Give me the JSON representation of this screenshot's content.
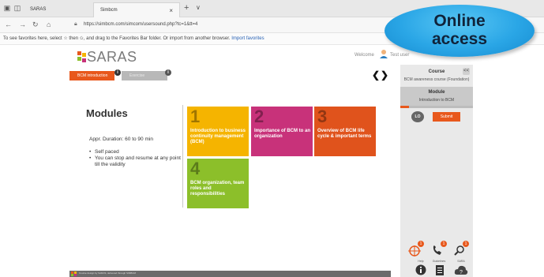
{
  "browser": {
    "tabs": [
      {
        "label": "SARAS"
      },
      {
        "label": "Simbcm",
        "close": "×"
      }
    ],
    "new_tab": "+",
    "tab_menu": "∨",
    "url": "https://simbcm.com/simcom/usersound.php?tc=1&tt=4",
    "favorites_text": "To see favorites here, select ☆ then ✩, and drag to the Favorites Bar folder. Or import from another browser.",
    "favorites_link": "Import favorites"
  },
  "bubble": {
    "line1": "Online",
    "line2": "access"
  },
  "app": {
    "logo_text": "SARAS",
    "welcome": "Welcome",
    "user": "Test user",
    "tabs": [
      {
        "label": "BCM introduction"
      },
      {
        "label": "Exercise"
      }
    ],
    "nav_prev": "❮",
    "nav_next": "❯",
    "modules_title": "Modules",
    "duration": "Appr. Duration: 60 to 90 min",
    "bullets": [
      "Self paced",
      "You can stop and resume at any point till the validity"
    ],
    "tiles": [
      {
        "num": "1",
        "label": "Introduction to business continuity management (BCM)",
        "color": "#f5b400"
      },
      {
        "num": "2",
        "label": "Importance of BCM to an organization",
        "color": "#c8327a"
      },
      {
        "num": "3",
        "label": "Overview of BCM life cycle & important terms",
        "color": "#e0531c"
      },
      {
        "num": "4",
        "label": "BCM organization, team roles and responsibilities",
        "color": "#8cbf2a"
      }
    ],
    "footer_text": "Course design by SARAS, delivered through SIMBCM"
  },
  "panel": {
    "course_title": "Course",
    "collapse": "<<",
    "course_name": "BCM awareness course (Foundation)",
    "module_title": "Module",
    "module_name": "Introduction to BCM",
    "progress": 0.12,
    "lo": "LO",
    "submit": "Submit",
    "tools": [
      {
        "label": "",
        "badge": "1"
      },
      {
        "label": "",
        "badge": "1"
      },
      {
        "label": "",
        "badge": "1"
      }
    ],
    "bottom": [
      {
        "label": "Help"
      },
      {
        "label": "Guidelines"
      },
      {
        "label": "SARA"
      }
    ]
  },
  "colors": {
    "accent": "#e8581c",
    "bubble": "#2aa6e6"
  }
}
